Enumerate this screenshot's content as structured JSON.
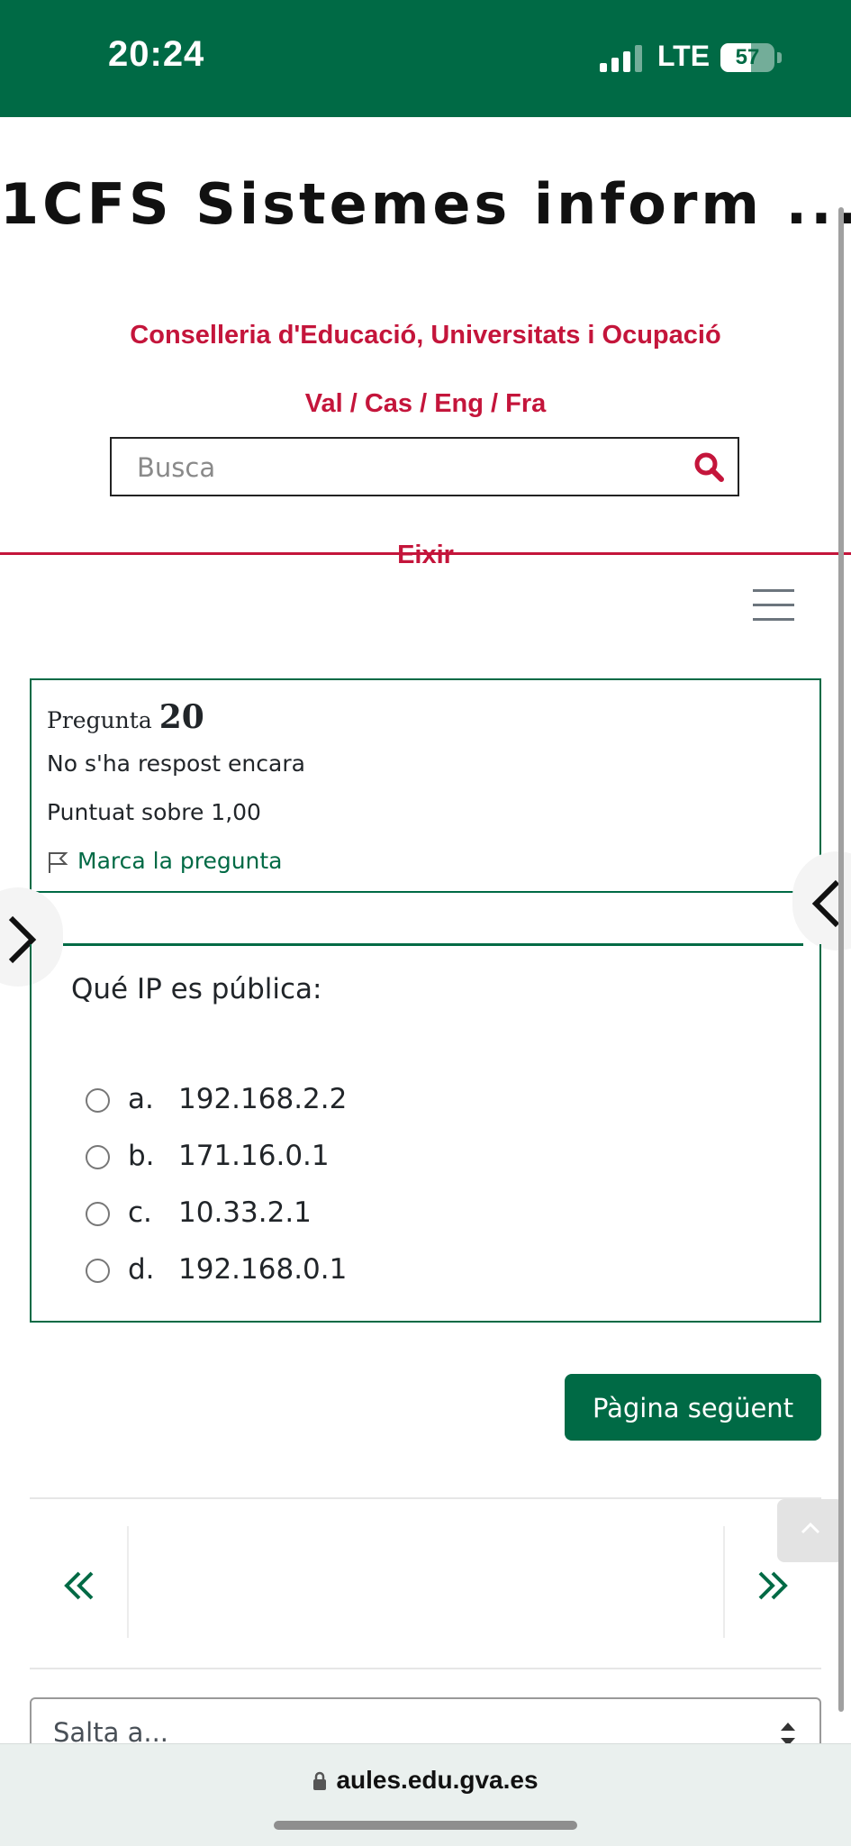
{
  "status_bar": {
    "time": "20:24",
    "network": "LTE",
    "battery": "57",
    "battery_fraction": 0.57
  },
  "header": {
    "site_title": "1CFS Sistemes inform ...",
    "ministry": "Conselleria d'Educació, Universitats i Ocupació",
    "languages": "Val / Cas / Eng / Fra",
    "search_placeholder": "Busca",
    "logout": "Eixir"
  },
  "question_info": {
    "label": "Pregunta",
    "number": "20",
    "state": "No s'ha respost encara",
    "grade": "Puntuat sobre 1,00",
    "flag": "Marca la pregunta"
  },
  "question": {
    "text": "Qué IP es pública:",
    "answers": [
      {
        "letter": "a.",
        "value": "192.168.2.2"
      },
      {
        "letter": "b.",
        "value": "171.16.0.1"
      },
      {
        "letter": "c.",
        "value": "10.33.2.1"
      },
      {
        "letter": "d.",
        "value": "192.168.0.1"
      }
    ]
  },
  "next_button": "Pàgina següent",
  "jump_to": "Salta a...",
  "browser": {
    "url": "aules.edu.gva.es"
  },
  "colors": {
    "brand_green": "#006a45",
    "accent_red": "#c4153b"
  }
}
